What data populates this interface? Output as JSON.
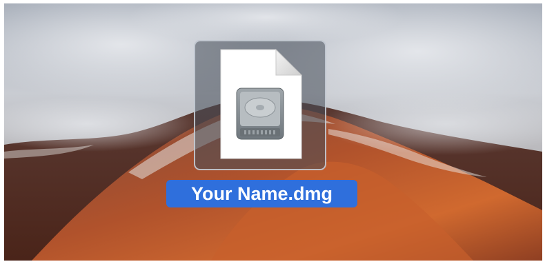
{
  "desktop": {
    "file_icon": {
      "icon": "disk-image-icon",
      "filename": "Your Name.dmg",
      "selected": true
    }
  },
  "colors": {
    "selection": "#2f6fdc",
    "label_text": "#ffffff"
  }
}
